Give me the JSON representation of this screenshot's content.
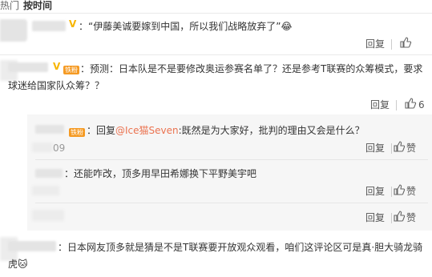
{
  "header": {
    "tab_hot": "热门",
    "tab_time": "按时间"
  },
  "comments": [
    {
      "text": "：“伊藤美诚要嫁到中国，所以我们战略放弃了”",
      "emoji": "😂",
      "reply_label": "回复",
      "like_label": ""
    },
    {
      "text_line1": "：预测：日本队是不是要修改奥运参赛名单了？还是参考T联赛的众筹模式，要求",
      "text_line2": "球迷给国家队众筹？？",
      "reply_label": "回复",
      "like_count": "6",
      "fan_badge": "铁粉"
    }
  ],
  "replies": [
    {
      "prefix": "：回复",
      "mention": "@Ice猫Seven",
      "text": ":既然是为大家好，批判的理由又会是什么？",
      "time_fragment": "09",
      "reply_label": "回复",
      "like_label": "赞",
      "fan_badge": "铁粉"
    },
    {
      "text": "：还能咋改，顶多用早田希娜换下平野美宇吧",
      "reply_label": "回复",
      "like_label": "赞"
    },
    {
      "reply_label": "回复",
      "like_label": "赞"
    }
  ],
  "last_comment": {
    "text_line1": "：日本网友顶多就是猜是不是T联赛要开放观众观看，咱们这评论区可是真·胆大骑龙骑",
    "text_line2": "虎",
    "emoji": "🐱"
  },
  "colors": {
    "link": "#eb7350",
    "verified": "#f7b500",
    "fan_badge": "#f59a23"
  }
}
